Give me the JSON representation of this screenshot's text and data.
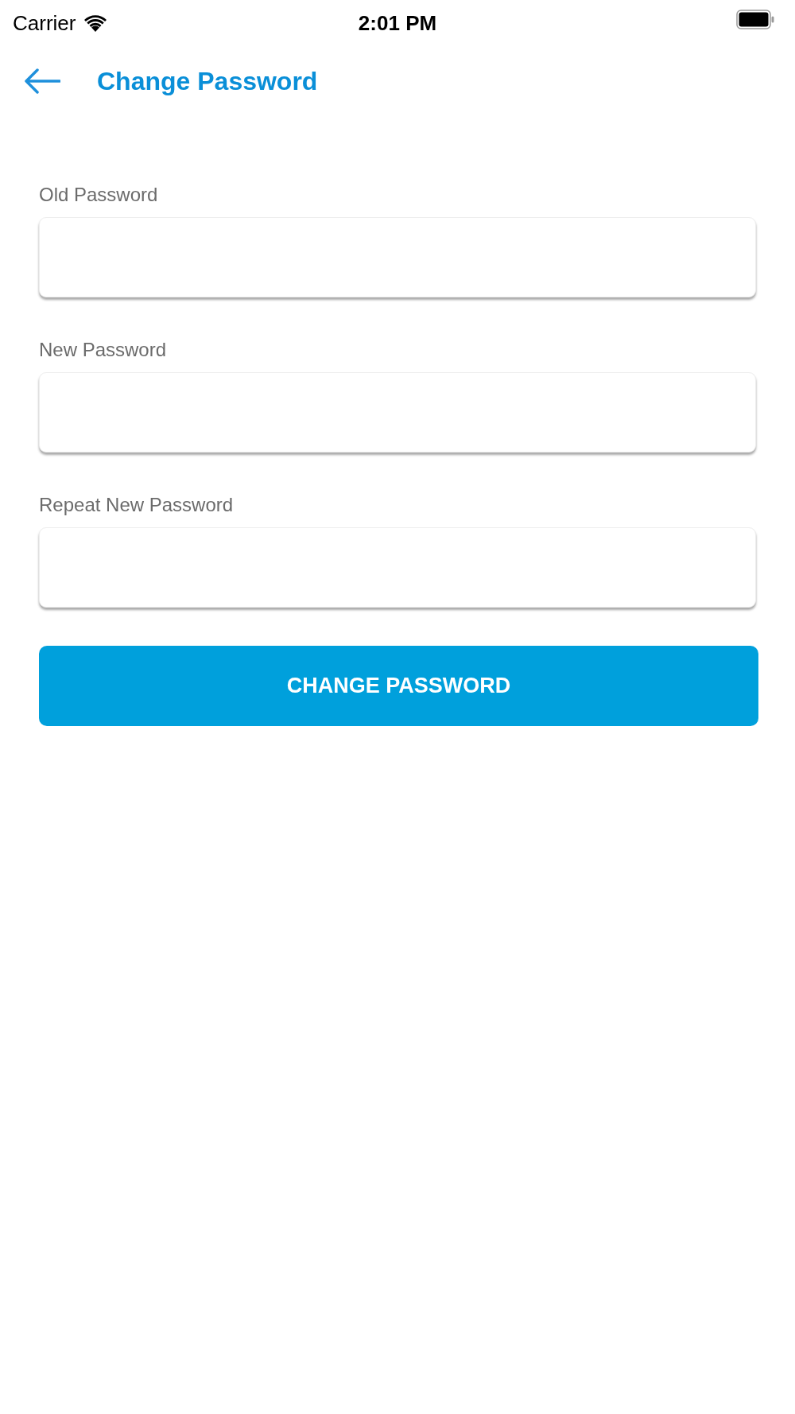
{
  "status_bar": {
    "carrier": "Carrier",
    "time": "2:01 PM"
  },
  "header": {
    "title": "Change Password"
  },
  "fields": [
    {
      "label": "Old Password"
    },
    {
      "label": "New Password"
    },
    {
      "label": "Repeat New Password"
    }
  ],
  "submit_button": {
    "label": "CHANGE PASSWORD"
  }
}
